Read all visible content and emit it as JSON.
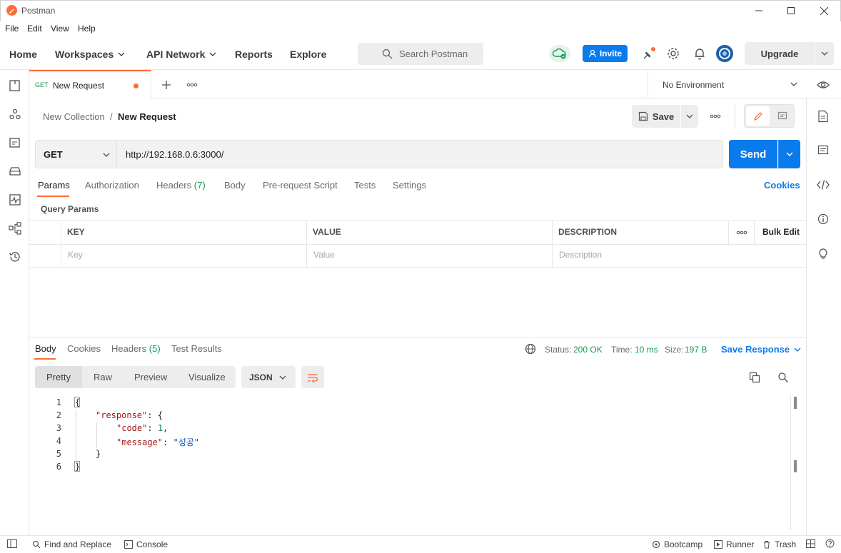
{
  "window": {
    "title": "Postman"
  },
  "menu": [
    "File",
    "Edit",
    "View",
    "Help"
  ],
  "nav": {
    "home": "Home",
    "workspaces": "Workspaces",
    "api_network": "API Network",
    "reports": "Reports",
    "explore": "Explore"
  },
  "search": {
    "placeholder": "Search Postman"
  },
  "header": {
    "invite": "Invite",
    "upgrade": "Upgrade"
  },
  "tab": {
    "method": "GET",
    "name": "New Request"
  },
  "environment": {
    "selected": "No Environment"
  },
  "breadcrumb": {
    "collection": "New Collection",
    "separator": "/",
    "request": "New Request"
  },
  "actions": {
    "save": "Save"
  },
  "request": {
    "method": "GET",
    "url": "http://192.168.0.6:3000/",
    "send": "Send"
  },
  "request_tabs": {
    "params": "Params",
    "authorization": "Authorization",
    "headers": "Headers",
    "headers_count": "(7)",
    "body": "Body",
    "pre_request": "Pre-request Script",
    "tests": "Tests",
    "settings": "Settings",
    "cookies": "Cookies"
  },
  "query_params": {
    "title": "Query Params",
    "headers": {
      "key": "KEY",
      "value": "VALUE",
      "description": "DESCRIPTION",
      "bulk_edit": "Bulk Edit"
    },
    "placeholders": {
      "key": "Key",
      "value": "Value",
      "description": "Description"
    }
  },
  "response_tabs": {
    "body": "Body",
    "cookies": "Cookies",
    "headers": "Headers",
    "headers_count": "(5)",
    "test_results": "Test Results"
  },
  "response_meta": {
    "status_label": "Status:",
    "status": "200 OK",
    "time_label": "Time:",
    "time": "10 ms",
    "size_label": "Size:",
    "size": "197 B",
    "save_response": "Save Response"
  },
  "view_modes": {
    "pretty": "Pretty",
    "raw": "Raw",
    "preview": "Preview",
    "visualize": "Visualize",
    "format": "JSON"
  },
  "code": {
    "line_numbers": [
      "1",
      "2",
      "3",
      "4",
      "5",
      "6"
    ],
    "l1": "{",
    "l2_key": "\"response\"",
    "l2_rest": ": {",
    "l3_key": "\"code\"",
    "l3_sep": ": ",
    "l3_val": "1",
    "l3_end": ",",
    "l4_key": "\"message\"",
    "l4_sep": ": ",
    "l4_val": "\"성공\"",
    "l5": "}",
    "l6": "}"
  },
  "statusbar": {
    "find_replace": "Find and Replace",
    "console": "Console",
    "bootcamp": "Bootcamp",
    "runner": "Runner",
    "trash": "Trash"
  },
  "colors": {
    "accent": "#ff6c37",
    "primary": "#097bed",
    "success": "#0f9d58"
  }
}
